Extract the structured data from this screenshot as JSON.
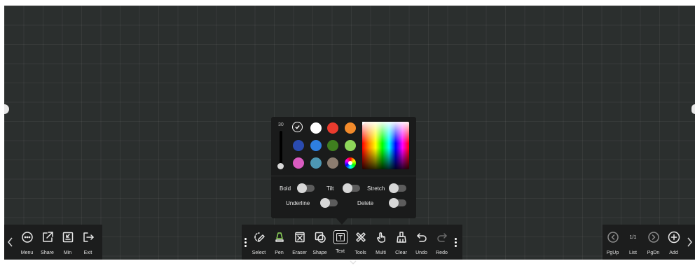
{
  "left_bar": {
    "items": [
      {
        "label": "Menu",
        "icon": "menu-icon"
      },
      {
        "label": "Share",
        "icon": "share-icon"
      },
      {
        "label": "Min",
        "icon": "minimize-icon"
      },
      {
        "label": "Exit",
        "icon": "exit-icon"
      }
    ]
  },
  "center_bar": {
    "items": [
      {
        "label": "Select",
        "icon": "select-icon"
      },
      {
        "label": "Pen",
        "icon": "pen-icon"
      },
      {
        "label": "Eraser",
        "icon": "eraser-icon"
      },
      {
        "label": "Shape",
        "icon": "shape-icon"
      },
      {
        "label": "Text",
        "icon": "text-icon",
        "active": true
      },
      {
        "label": "Tools",
        "icon": "tools-icon"
      },
      {
        "label": "Multi",
        "icon": "multi-touch-icon"
      },
      {
        "label": "Clear",
        "icon": "clear-icon"
      },
      {
        "label": "Undo",
        "icon": "undo-icon"
      },
      {
        "label": "Redo",
        "icon": "redo-icon",
        "disabled": true
      }
    ]
  },
  "right_bar": {
    "page_indicator": "1/1",
    "items": [
      {
        "label": "PgUp",
        "icon": "page-up-icon"
      },
      {
        "label": "List",
        "icon": "page-list"
      },
      {
        "label": "PgDn",
        "icon": "page-down-icon"
      },
      {
        "label": "Add",
        "icon": "add-page-icon"
      }
    ]
  },
  "text_panel": {
    "size_value": "30",
    "size_level": 0.0,
    "selected_color": "#222222",
    "colors": [
      "#222222",
      "#ffffff",
      "#ea3b2e",
      "#f28a2b",
      "#2a4bb0",
      "#2e7fe0",
      "#3f7f1f",
      "#8ed65a",
      "#d95bc0",
      "#4d97b3",
      "#8c7d70",
      "spectrum"
    ],
    "options": {
      "bold_label": "Bold",
      "tilt_label": "Tilt",
      "stretch_label": "Stretch",
      "underline_label": "Underline",
      "delete_label": "Delete"
    },
    "toggles": {
      "bold": false,
      "tilt": false,
      "stretch": false,
      "underline": false,
      "delete": false
    }
  },
  "colors": {
    "canvas": "#2b2f2e",
    "toolbar": "#1c1d1d",
    "panel": "#1a1b1b"
  }
}
